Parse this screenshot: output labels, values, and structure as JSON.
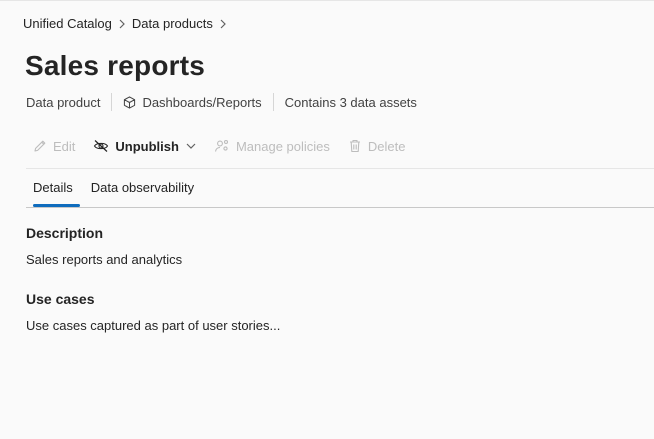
{
  "breadcrumb": {
    "items": [
      "Unified Catalog",
      "Data products"
    ]
  },
  "page": {
    "title": "Sales reports"
  },
  "meta": {
    "type": "Data product",
    "category": "Dashboards/Reports",
    "assets": "Contains 3 data assets"
  },
  "toolbar": {
    "edit": "Edit",
    "unpublish": "Unpublish",
    "manage_policies": "Manage policies",
    "delete": "Delete"
  },
  "tabs": [
    {
      "label": "Details",
      "active": true
    },
    {
      "label": "Data observability",
      "active": false
    }
  ],
  "details": {
    "description_heading": "Description",
    "description_text": "Sales reports and analytics",
    "use_cases_heading": "Use cases",
    "use_cases_text": "Use cases captured as part of user stories..."
  },
  "colors": {
    "accent": "#0f6cbd",
    "disabled": "#bdbdbd",
    "text": "#242424"
  }
}
